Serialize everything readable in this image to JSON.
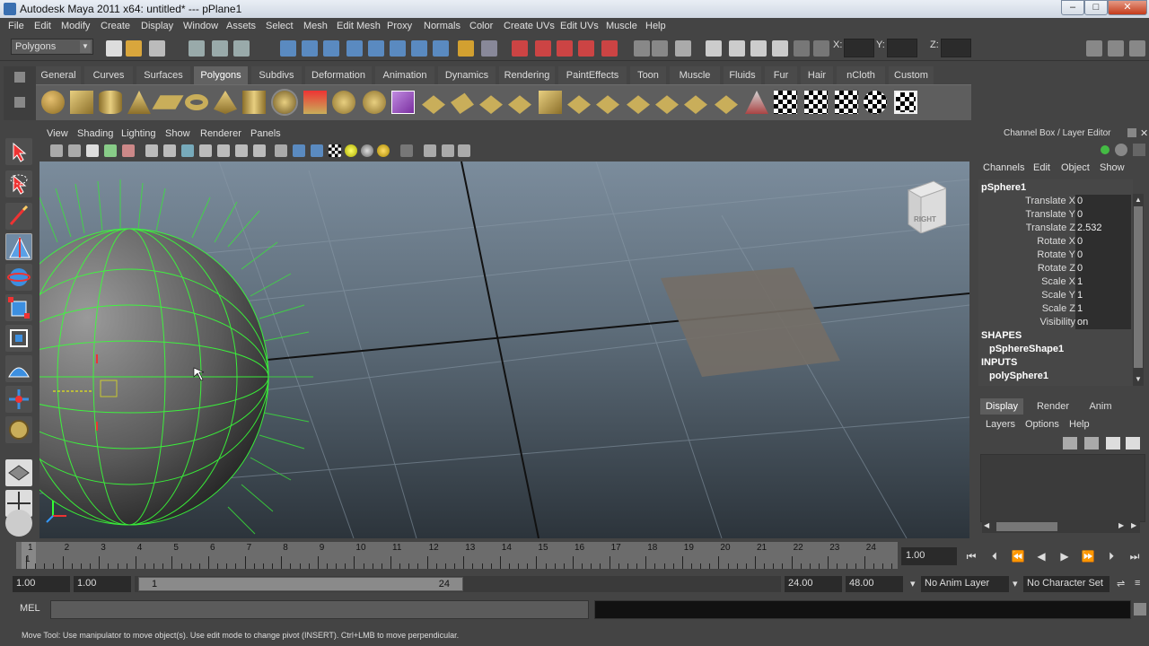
{
  "window": {
    "title": "Autodesk Maya 2011 x64: untitled*   ---   pPlane1"
  },
  "menubar": [
    "File",
    "Edit",
    "Modify",
    "Create",
    "Display",
    "Window",
    "Assets",
    "Select",
    "Mesh",
    "Edit Mesh",
    "Proxy",
    "Normals",
    "Color",
    "Create UVs",
    "Edit UVs",
    "Muscle",
    "Help"
  ],
  "status_line": {
    "mode": "Polygons",
    "x_label": "X:",
    "y_label": "Y:",
    "z_label": "Z:"
  },
  "shelf": {
    "tabs": [
      "General",
      "Curves",
      "Surfaces",
      "Polygons",
      "Subdivs",
      "Deformation",
      "Animation",
      "Dynamics",
      "Rendering",
      "PaintEffects",
      "Toon",
      "Muscle",
      "Fluids",
      "Fur",
      "Hair",
      "nCloth",
      "Custom"
    ],
    "active": "Polygons"
  },
  "panel_menu": [
    "View",
    "Shading",
    "Lighting",
    "Show",
    "Renderer",
    "Panels"
  ],
  "viewcube": {
    "label": "RIGHT"
  },
  "channel_box": {
    "title": "Channel Box / Layer Editor",
    "menu": [
      "Channels",
      "Edit",
      "Object",
      "Show"
    ],
    "object": "pSphere1",
    "channels": [
      {
        "name": "Translate X",
        "value": "0"
      },
      {
        "name": "Translate Y",
        "value": "0"
      },
      {
        "name": "Translate Z",
        "value": "2.532"
      },
      {
        "name": "Rotate X",
        "value": "0"
      },
      {
        "name": "Rotate Y",
        "value": "0"
      },
      {
        "name": "Rotate Z",
        "value": "0"
      },
      {
        "name": "Scale X",
        "value": "1"
      },
      {
        "name": "Scale Y",
        "value": "1"
      },
      {
        "name": "Scale Z",
        "value": "1"
      },
      {
        "name": "Visibility",
        "value": "on"
      }
    ],
    "shapes_header": "SHAPES",
    "shape": "pSphereShape1",
    "inputs_header": "INPUTS",
    "input": "polySphere1"
  },
  "layer_editor": {
    "tabs": [
      "Display",
      "Render",
      "Anim"
    ],
    "active": "Display",
    "menu": [
      "Layers",
      "Options",
      "Help"
    ]
  },
  "timeline": {
    "frames": [
      "1",
      "2",
      "3",
      "4",
      "5",
      "6",
      "7",
      "8",
      "9",
      "10",
      "11",
      "12",
      "13",
      "14",
      "15",
      "16",
      "17",
      "18",
      "19",
      "20",
      "21",
      "22",
      "23",
      "24"
    ],
    "current_marker": "1",
    "current_frame": "1.00"
  },
  "range": {
    "start_time": "1.00",
    "playback_start": "1.00",
    "slider_start": "1",
    "slider_end": "24",
    "playback_end": "24.00",
    "end_time": "48.00",
    "anim_layer": "No Anim Layer",
    "character_set": "No Character Set"
  },
  "command_line": {
    "label": "MEL"
  },
  "help_line": "Move Tool: Use manipulator to move object(s). Use edit mode to change pivot (INSERT). Ctrl+LMB to move perpendicular.",
  "colors": {
    "viewport_top": "#7b8c9c",
    "viewport_bottom": "#2c343b",
    "wireframe_selected": "#39ff39",
    "ui_background": "#444444"
  }
}
